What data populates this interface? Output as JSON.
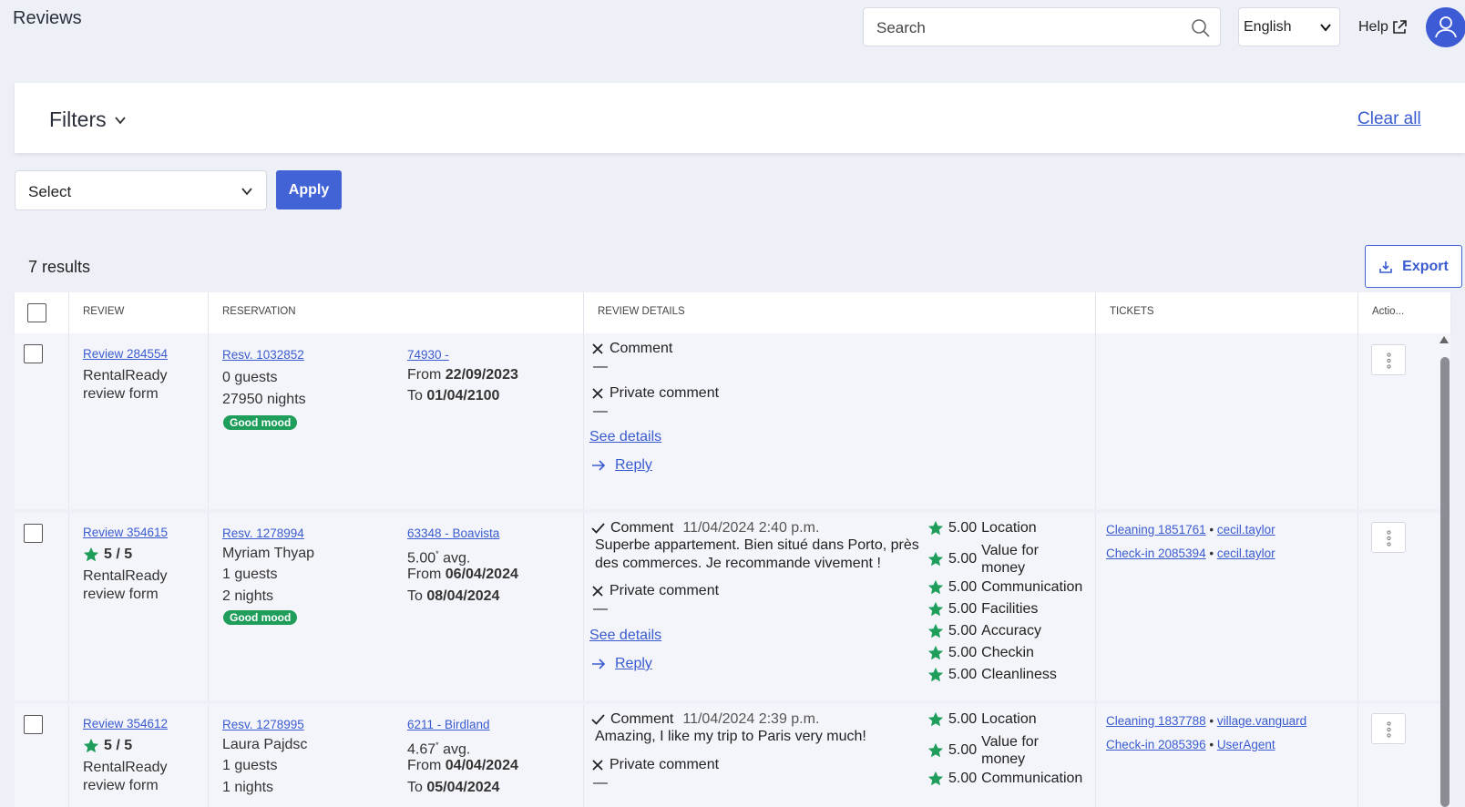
{
  "header": {
    "title": "Reviews",
    "search_placeholder": "Search",
    "language": "English",
    "help": "Help"
  },
  "filters": {
    "title": "Filters",
    "clear_all": "Clear all",
    "select_value": "Select",
    "apply": "Apply"
  },
  "results": {
    "count_text": "7 results",
    "export": "Export"
  },
  "columns": [
    "Review",
    "Reservation",
    "Review details",
    "Tickets",
    "Actio..."
  ],
  "rows": [
    {
      "review_link": "Review 284554",
      "review_form_1": "RentalReady",
      "review_form_2": "review form",
      "resv_link": "Resv. 1032852",
      "guests": "0 guests",
      "nights": "27950 nights",
      "mood": "Good mood",
      "property_link": "74930 -",
      "from_label": "From",
      "from_date": "22/09/2023",
      "to_label": "To",
      "to_date": "01/04/2100",
      "comment_label": "Comment",
      "comment_dash": "—",
      "private_label": "Private comment",
      "private_dash": "—",
      "see_details": "See details",
      "reply": "Reply"
    },
    {
      "review_link": "Review 354615",
      "rating": "5 / 5",
      "review_form_1": "RentalReady",
      "review_form_2": "review form",
      "resv_link": "Resv. 1278994",
      "guest_name": "Myriam Thyap",
      "guests": "1 guests",
      "nights": "2 nights",
      "mood": "Good mood",
      "property_link": "63348 - Boavista",
      "avg": "5.00",
      "avg_sup": "*",
      "avg_label": "avg.",
      "from_label": "From",
      "from_date": "06/04/2024",
      "to_label": "To",
      "to_date": "08/04/2024",
      "comment_label": "Comment",
      "comment_date": "11/04/2024 2:40 p.m.",
      "comment_text_1": "Superbe appartement. Bien situé dans Porto, près",
      "comment_text_2": "des commerces. Je recommande vivement !",
      "private_label": "Private comment",
      "private_dash": "—",
      "see_details": "See details",
      "reply": "Reply",
      "scores": [
        {
          "value": "5.00",
          "label": "Location"
        },
        {
          "value": "5.00",
          "label": "Value for",
          "label2": "money"
        },
        {
          "value": "5.00",
          "label": "Communication"
        },
        {
          "value": "5.00",
          "label": "Facilities"
        },
        {
          "value": "5.00",
          "label": "Accuracy"
        },
        {
          "value": "5.00",
          "label": "Checkin"
        },
        {
          "value": "5.00",
          "label": "Cleanliness"
        }
      ],
      "tickets": [
        {
          "ticket": "Cleaning 1851761",
          "user": "cecil.taylor"
        },
        {
          "ticket": "Check-in 2085394",
          "user": "cecil.taylor"
        }
      ]
    },
    {
      "review_link": "Review 354612",
      "rating": "5 / 5",
      "review_form_1": "RentalReady",
      "review_form_2": "review form",
      "resv_link": "Resv. 1278995",
      "guest_name": "Laura Pajdsc",
      "guests": "1 guests",
      "nights": "1 nights",
      "property_link": "6211 - Birdland",
      "avg": "4.67",
      "avg_sup": "*",
      "avg_label": "avg.",
      "from_label": "From",
      "from_date": "04/04/2024",
      "to_label": "To",
      "to_date": "05/04/2024",
      "comment_label": "Comment",
      "comment_date": "11/04/2024 2:39 p.m.",
      "comment_text_1": "Amazing, I like my trip to Paris very much!",
      "private_label": "Private comment",
      "private_dash": "—",
      "scores": [
        {
          "value": "5.00",
          "label": "Location"
        },
        {
          "value": "5.00",
          "label": "Value for",
          "label2": "money"
        },
        {
          "value": "5.00",
          "label": "Communication"
        }
      ],
      "tickets": [
        {
          "ticket": "Cleaning 1837788",
          "user": "village.vanguard"
        },
        {
          "ticket": "Check-in 2085396",
          "user": "UserAgent"
        }
      ]
    }
  ],
  "colors": {
    "accent": "#4263d6",
    "link": "#3a5bd0",
    "good_mood": "#1e9e5a",
    "star": "#1e9e5a",
    "background": "#eef0f8"
  }
}
